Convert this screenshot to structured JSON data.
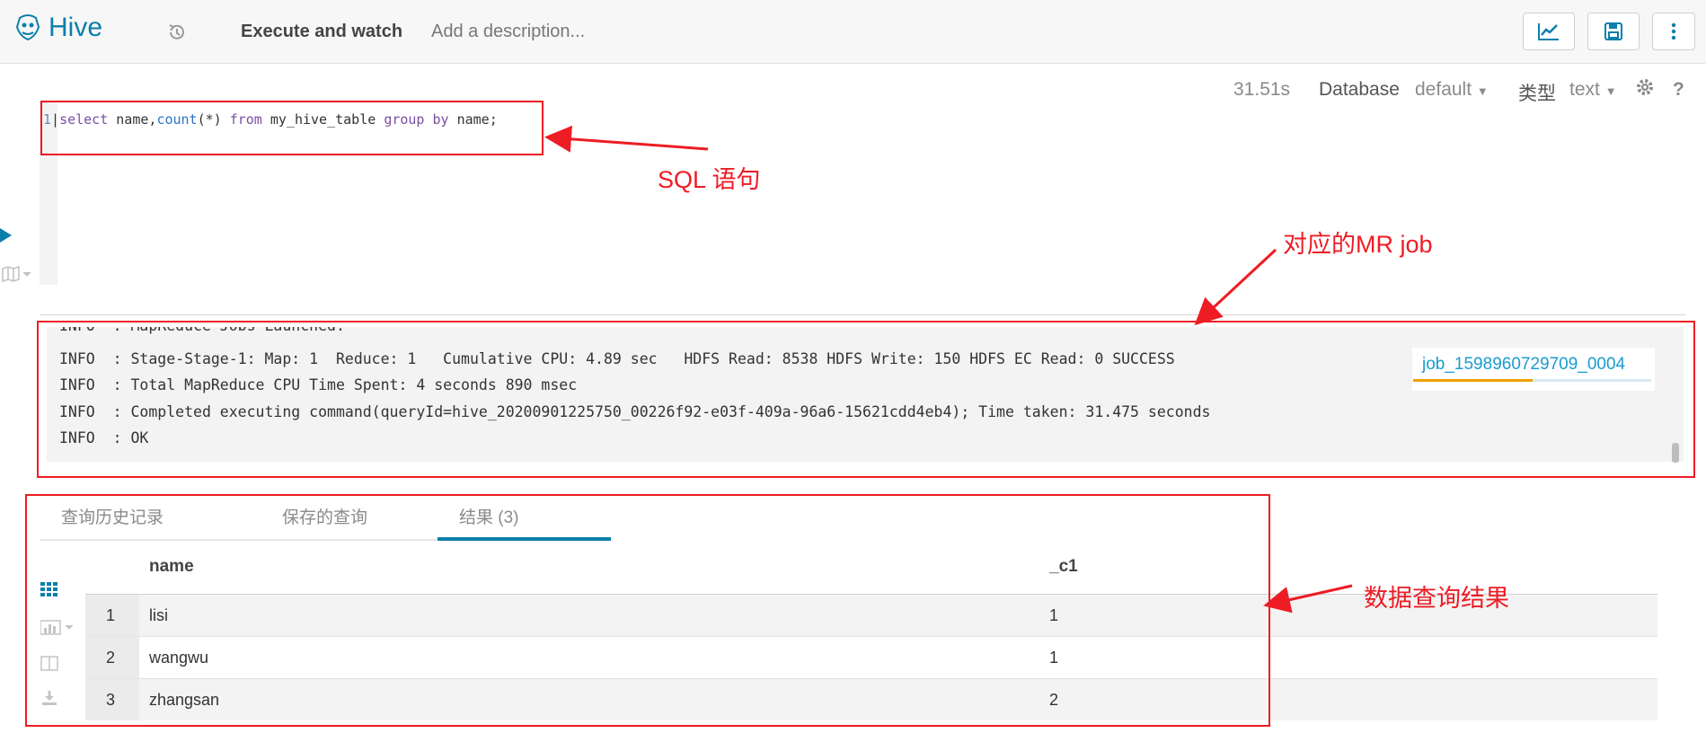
{
  "app": {
    "title": "Hive"
  },
  "toolbar": {
    "title": "Execute and watch",
    "description_placeholder": "Add a description...",
    "chart_icon": "line-chart-icon",
    "save_icon": "floppy-save-icon",
    "menu_icon": "vertical-dots-icon"
  },
  "editor_meta": {
    "duration": "31.51s",
    "database_label": "Database",
    "database_value": "default",
    "type_label": "类型",
    "type_value": "text"
  },
  "editor": {
    "line_number": "1",
    "query_tokens": [
      "select",
      " name,",
      "count",
      "(*) ",
      "from",
      " my_hive_table ",
      "group",
      " ",
      "by",
      " name;"
    ]
  },
  "log": {
    "lines": [
      "INFO  : MapReduce Jobs Launched:",
      "INFO  : Stage-Stage-1: Map: 1  Reduce: 1   Cumulative CPU: 4.89 sec   HDFS Read: 8538 HDFS Write: 150 HDFS EC Read: 0 SUCCESS",
      "INFO  : Total MapReduce CPU Time Spent: 4 seconds 890 msec",
      "INFO  : Completed executing command(queryId=hive_20200901225750_00226f92-e03f-409a-96a6-15621cdd4eb4); Time taken: 31.475 seconds",
      "INFO  : OK"
    ],
    "job_id": "job_1598960729709_0004",
    "job_progress": 0.5
  },
  "tabs": [
    "查询历史记录",
    "保存的查询",
    "结果 (3)"
  ],
  "results": {
    "columns": [
      "name",
      "_c1"
    ],
    "rows": [
      {
        "num": "1",
        "name": "lisi",
        "c1": "1"
      },
      {
        "num": "2",
        "name": "wangwu",
        "c1": "1"
      },
      {
        "num": "3",
        "name": "zhangsan",
        "c1": "2"
      }
    ]
  },
  "annotations": {
    "sql": "SQL 语句",
    "mr_job": "对应的MR job",
    "result": "数据查询结果",
    "color": "#ee1c24"
  },
  "colors": {
    "accent": "#0b7fab",
    "link": "#1a9bd0",
    "progress": "#f0a000"
  }
}
